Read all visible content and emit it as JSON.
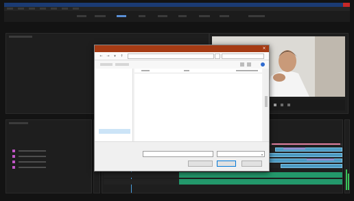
{
  "window": {
    "title": ""
  },
  "menubar": {
    "items": [
      "",
      "",
      "",
      "",
      "",
      "",
      ""
    ]
  },
  "dialog": {
    "title": "",
    "address": "",
    "nav_items": [
      "",
      "",
      "",
      "",
      "",
      "",
      "",
      "",
      "",
      "",
      "",
      ""
    ],
    "files": [
      "",
      "",
      "",
      "",
      "",
      "",
      "",
      "",
      "",
      "",
      "",
      "",
      "",
      "",
      "",
      ""
    ],
    "filename_label": "",
    "filename_value": "",
    "filetype": "",
    "buttons": {
      "left": "",
      "open": "",
      "cancel": ""
    }
  },
  "colors": {
    "app_background": "#131313",
    "titlebar": "#1b3b73",
    "dialog_titlebar": "#a53b14",
    "accent": "#5a8fd6",
    "clip_video": "#4d9bc2",
    "clip_audio": "#23986b",
    "clip_label": "#c156c6"
  },
  "icons": {
    "dialog_close": "×",
    "back": "←",
    "forward": "→",
    "up": "↑",
    "dropdown": "▾"
  }
}
